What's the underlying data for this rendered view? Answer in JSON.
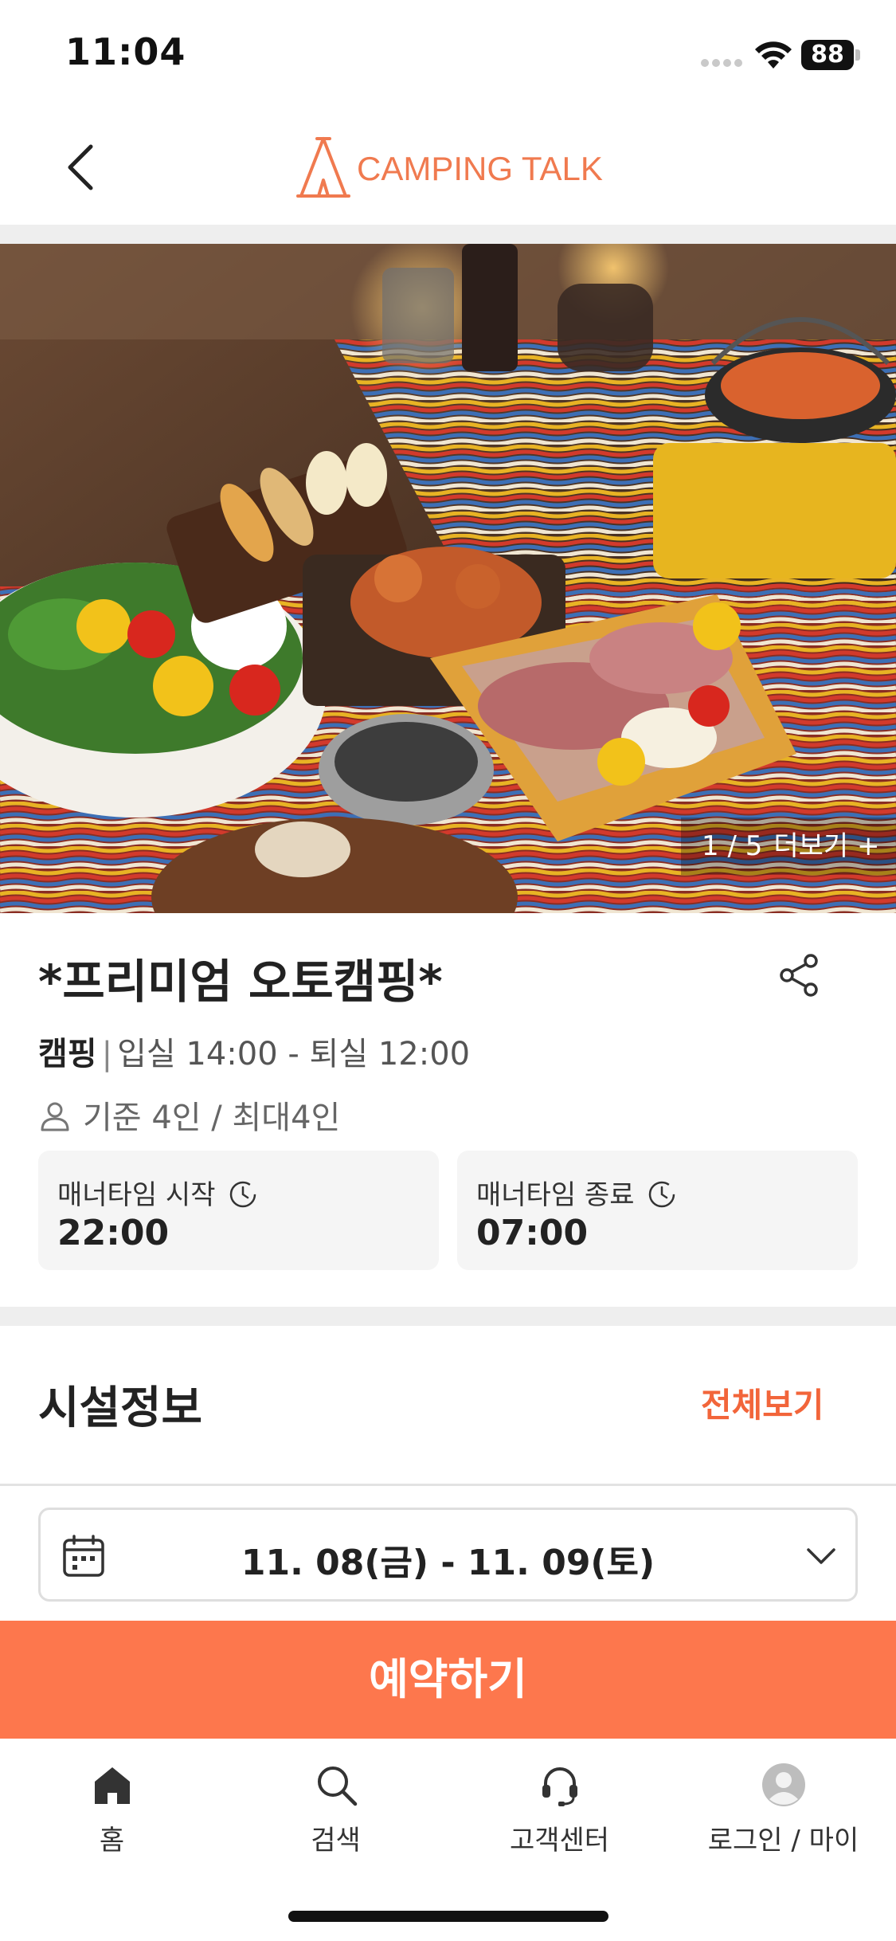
{
  "status_bar": {
    "time": "11:04",
    "battery": "88"
  },
  "header": {
    "logo_text": "CAMPING TALK"
  },
  "gallery": {
    "counter": "1 / 5",
    "more_label": "더보기 +"
  },
  "product": {
    "title": "*프리미엄 오토캠핑*",
    "category": "캠핑",
    "checkin_checkout": "입실 14:00 - 퇴실 12:00",
    "capacity": "기준 4인 / 최대4인"
  },
  "manner_time": {
    "start_label": "매너타임 시작",
    "start_time": "22:00",
    "end_label": "매너타임 종료",
    "end_time": "07:00"
  },
  "facilities": {
    "title": "시설정보",
    "view_all": "전체보기"
  },
  "date_select": {
    "value": "11. 08(금) - 11. 09(토)"
  },
  "reserve": {
    "label": "예약하기"
  },
  "tabbar": {
    "items": [
      {
        "label": "홈",
        "icon": "home-icon"
      },
      {
        "label": "검색",
        "icon": "search-icon"
      },
      {
        "label": "고객센터",
        "icon": "headset-icon"
      },
      {
        "label": "로그인 / 마이",
        "icon": "avatar-icon"
      }
    ]
  },
  "colors": {
    "accent": "#fd774d",
    "accent_text": "#f2653a",
    "logo": "#f07a4f"
  }
}
